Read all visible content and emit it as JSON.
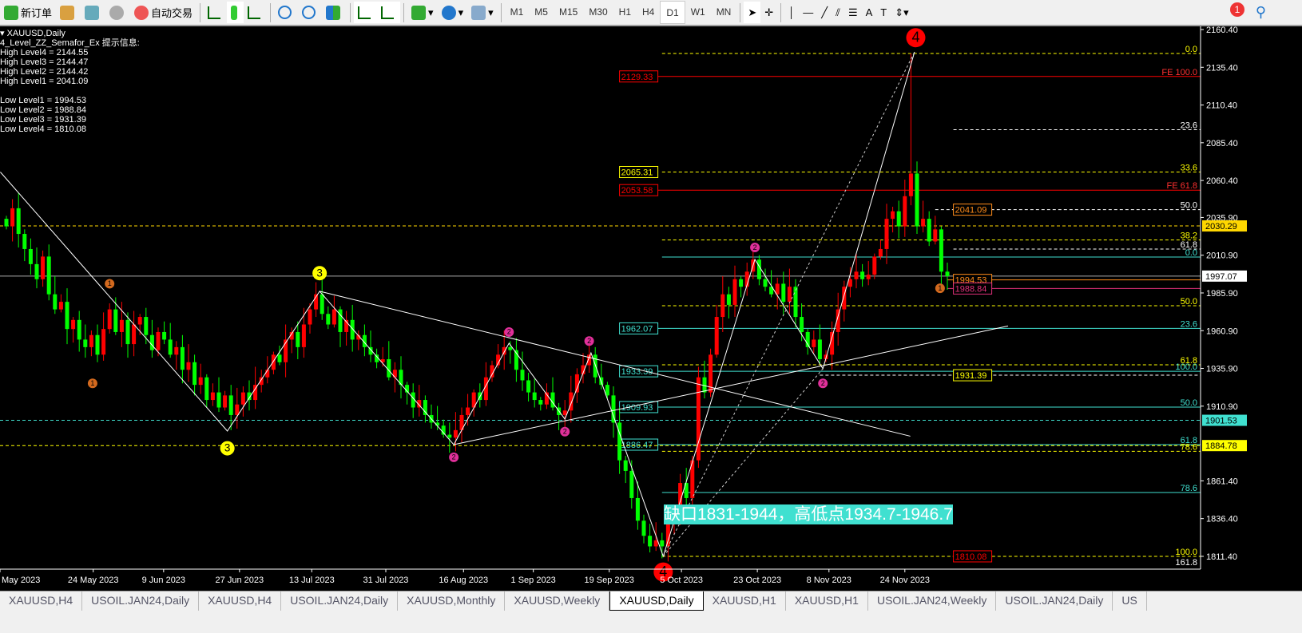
{
  "toolbar": {
    "new_order": "新订单",
    "auto_trading": "自动交易",
    "timeframes": [
      "M1",
      "M5",
      "M15",
      "M30",
      "H1",
      "H4",
      "D1",
      "W1",
      "MN"
    ],
    "active_timeframe": "D1",
    "alert_count": "1"
  },
  "info": {
    "symbol": "XAUUSD,Daily",
    "indicator": "4_Level_ZZ_Semafor_Ex 提示信息:",
    "lines": [
      "High Level4 = 2144.55",
      "High Level3 = 2144.47",
      "High Level2 = 2144.42",
      "High Level1 = 2041.09",
      "",
      "Low Level1 = 1994.53",
      "Low Level2 = 1988.84",
      "Low Level3 = 1931.39",
      "Low Level4 = 1810.08"
    ]
  },
  "annotation": "缺口1831-1944，高低点1934.7-1946.7",
  "tabs": [
    "XAUUSD,H4",
    "USOIL.JAN24,Daily",
    "XAUUSD,H4",
    "USOIL.JAN24,Daily",
    "XAUUSD,Monthly",
    "XAUUSD,Weekly",
    "XAUUSD,Daily",
    "XAUUSD,H1",
    "XAUUSD,H1",
    "USOIL.JAN24,Weekly",
    "USOIL.JAN24,Daily",
    "US"
  ],
  "active_tab": 6,
  "chart_data": {
    "type": "candlestick",
    "symbol": "XAUUSD",
    "timeframe": "Daily",
    "ylim": [
      1804,
      2162
    ],
    "bull_color": "#ff0000",
    "bear_color": "#00ff00",
    "closes": [
      2030,
      2042,
      2025,
      2015,
      2005,
      1995,
      2010,
      1985,
      1975,
      1980,
      1962,
      1968,
      1955,
      1950,
      1958,
      1945,
      1962,
      1975,
      1960,
      1968,
      1952,
      1965,
      1970,
      1958,
      1948,
      1960,
      1955,
      1945,
      1950,
      1935,
      1940,
      1925,
      1930,
      1915,
      1920,
      1910,
      1918,
      1905,
      1912,
      1920,
      1915,
      1925,
      1930,
      1935,
      1945,
      1940,
      1955,
      1960,
      1950,
      1965,
      1975,
      1985,
      1972,
      1965,
      1975,
      1960,
      1968,
      1955,
      1958,
      1950,
      1945,
      1940,
      1942,
      1930,
      1935,
      1925,
      1920,
      1910,
      1915,
      1905,
      1900,
      1898,
      1892,
      1890,
      1895,
      1905,
      1910,
      1920,
      1915,
      1930,
      1938,
      1945,
      1950,
      1948,
      1935,
      1928,
      1920,
      1915,
      1912,
      1920,
      1910,
      1905,
      1908,
      1920,
      1932,
      1938,
      1945,
      1930,
      1925,
      1918,
      1900,
      1875,
      1868,
      1850,
      1835,
      1825,
      1818,
      1822,
      1818,
      1835,
      1840,
      1860,
      1850,
      1875,
      1930,
      1920,
      1945,
      1970,
      1985,
      1978,
      1995,
      1990,
      2000,
      2008,
      1995,
      1990,
      1985,
      1992,
      1980,
      1990,
      1970,
      1960,
      1950,
      1955,
      1942,
      1945,
      1960,
      1975,
      1990,
      1995,
      2000,
      1995,
      1998,
      2010,
      2015,
      2035,
      2040,
      2030,
      2050,
      2065,
      2030,
      2035,
      2020,
      2028,
      2000,
      1997
    ],
    "high_overrides": {
      "149": 2144.55,
      "108": 1810.08
    },
    "y_ticks": [
      "2160.40",
      "2135.40",
      "2110.40",
      "2085.40",
      "2060.40",
      "2035.90",
      "2010.90",
      "1985.90",
      "1960.90",
      "1935.90",
      "1910.90",
      "1861.40",
      "1836.40",
      "1811.40"
    ],
    "x_ticks": [
      {
        "i": 2,
        "label": "May 2023"
      },
      {
        "i": 14.3,
        "label": "24 May 2023"
      },
      {
        "i": 25.9,
        "label": "9 Jun 2023"
      },
      {
        "i": 38.4,
        "label": "27 Jun 2023"
      },
      {
        "i": 50.3,
        "label": "13 Jul 2023"
      },
      {
        "i": 62.5,
        "label": "31 Jul 2023"
      },
      {
        "i": 75.3,
        "label": "16 Aug 2023"
      },
      {
        "i": 86.8,
        "label": "1 Sep 2023"
      },
      {
        "i": 99.3,
        "label": "19 Sep 2023"
      },
      {
        "i": 111.2,
        "label": "5 Oct 2023"
      },
      {
        "i": 123.7,
        "label": "23 Oct 2023"
      },
      {
        "i": 135.5,
        "label": "8 Nov 2023"
      },
      {
        "i": 148,
        "label": "24 Nov 2023"
      }
    ],
    "price_tags": [
      {
        "price": 2030.29,
        "label": "2030.29",
        "color": "#ffd700"
      },
      {
        "price": 1997.07,
        "label": "1997.07",
        "color": "#ffffff"
      },
      {
        "price": 1901.53,
        "label": "1901.53",
        "color": "#40e0d0"
      },
      {
        "price": 1884.78,
        "label": "1884.78",
        "color": "#ffff00"
      }
    ],
    "levels": [
      {
        "price": 2144.55,
        "from": 108,
        "color": "#ffff00",
        "dash": true,
        "label": "0.0"
      },
      {
        "price": 2129.33,
        "from": 101,
        "color": "#ff0000",
        "dash": false,
        "label": "FE 100.0",
        "box": "2129.33",
        "box_at": 101
      },
      {
        "price": 2094,
        "from": 156,
        "color": "#ffffff",
        "dash": true,
        "label": "23.6"
      },
      {
        "price": 2066,
        "from": 108,
        "color": "#ffff00",
        "dash": true,
        "label": "33.6",
        "box": "2065.31",
        "box_at": 101
      },
      {
        "price": 2054,
        "from": 101,
        "color": "#ff0000",
        "dash": false,
        "label": "FE 61.8",
        "box": "2053.58",
        "box_at": 101
      },
      {
        "price": 2041.09,
        "from": 153,
        "color": "#ffffff",
        "dash": true,
        "label": "50.0",
        "box": "2041.09",
        "box_at": 156,
        "box_color": "#ff8c1a"
      },
      {
        "price": 2030.29,
        "from": -2,
        "color": "#ffd700",
        "dash": true,
        "label": ""
      },
      {
        "price": 2021,
        "from": 108,
        "color": "#ffff00",
        "dash": true,
        "label": "38.2"
      },
      {
        "price": 2015,
        "from": 156,
        "color": "#ffffff",
        "dash": true,
        "label": "61.8"
      },
      {
        "price": 2009.7,
        "from": 108,
        "color": "#40e0d0",
        "dash": false,
        "label": "0.0"
      },
      {
        "price": 1997.07,
        "from": -2,
        "color": "#aaaaaa",
        "dash": false,
        "label": ""
      },
      {
        "price": 1994.53,
        "from": 155,
        "color": "#ff8c1a",
        "dash": false,
        "label": "",
        "box": "1994.53",
        "box_at": 156,
        "box_color": "#ff8c1a"
      },
      {
        "price": 1988.84,
        "from": 155,
        "color": "#e0307a",
        "dash": false,
        "label": "",
        "box": "1988.84",
        "box_at": 156,
        "box_color": "#e0307a"
      },
      {
        "price": 1977.4,
        "from": 108,
        "color": "#ffff00",
        "dash": true,
        "label": "50.0"
      },
      {
        "price": 1962.4,
        "from": 101,
        "color": "#40e0d0",
        "dash": false,
        "label": "23.6",
        "box": "1962.07",
        "box_at": 101
      },
      {
        "price": 1938.3,
        "from": 108,
        "color": "#ffff00",
        "dash": true,
        "label": "61.8"
      },
      {
        "price": 1934,
        "from": 101,
        "color": "#40e0d0",
        "dash": false,
        "label": "100.0",
        "box": "1933.39",
        "box_at": 101
      },
      {
        "price": 1931.39,
        "from": 134,
        "color": "#ffffff",
        "dash": true,
        "label": "",
        "box": "1931.39",
        "box_at": 156,
        "box_color": "#ffff00"
      },
      {
        "price": 1910.3,
        "from": 101,
        "color": "#40e0d0",
        "dash": false,
        "label": "50.0",
        "box": "1909.93",
        "box_at": 101
      },
      {
        "price": 1901.53,
        "from": -2,
        "color": "#40e0d0",
        "dash": true,
        "label": ""
      },
      {
        "price": 1885.4,
        "from": 101,
        "color": "#40e0d0",
        "dash": false,
        "label": "61.8",
        "box": "1886.47",
        "box_at": 101
      },
      {
        "price": 1884.78,
        "from": -2,
        "color": "#ffff00",
        "dash": true,
        "label": ""
      },
      {
        "price": 1881,
        "from": 108,
        "color": "#ffff00",
        "dash": true,
        "label": "78.6"
      },
      {
        "price": 1853.7,
        "from": 108,
        "color": "#40e0d0",
        "dash": false,
        "label": "78.6"
      },
      {
        "price": 1811.4,
        "from": 108,
        "color": "#ffff00",
        "dash": true,
        "label": "100.0",
        "box": "1810.08",
        "box_at": 156,
        "box_color": "#ff0000"
      },
      {
        "price": 1804.5,
        "from": 108,
        "color": "#000000",
        "dash": false,
        "label": "161.8"
      }
    ],
    "zigzag": [
      [
        -1,
        2066
      ],
      [
        36.4,
        1894.4
      ],
      [
        51.6,
        1987
      ],
      [
        73.7,
        1885.4
      ],
      [
        82.8,
        1952.6
      ],
      [
        92,
        1902.3
      ],
      [
        96.3,
        1946.2
      ],
      [
        108.2,
        1811.4
      ],
      [
        123.3,
        2008.1
      ],
      [
        134.5,
        1935.7
      ],
      [
        149.6,
        2145.6
      ]
    ],
    "trendlines": [
      [
        [
          51.6,
          1987
        ],
        [
          148.9,
          1891
        ]
      ],
      [
        [
          73.7,
          1885.4
        ],
        [
          165,
          1964
        ]
      ]
    ],
    "dashed_lines": [
      [
        [
          108.2,
          1811.4
        ],
        [
          149.6,
          2145.6
        ]
      ],
      [
        [
          108.2,
          1811.4
        ],
        [
          134.5,
          1935.7
        ]
      ]
    ],
    "markers": [
      {
        "i": 17,
        "price": 1992,
        "n": "1",
        "color": "#d2691e"
      },
      {
        "i": 14.2,
        "price": 1926,
        "n": "1",
        "color": "#d2691e"
      },
      {
        "i": 153.8,
        "price": 1989,
        "n": "1",
        "color": "#d2691e"
      },
      {
        "i": 36.4,
        "price": 1883,
        "n": "3",
        "color": "#ffff00"
      },
      {
        "i": 51.6,
        "price": 1999,
        "n": "3",
        "color": "#ffff00"
      },
      {
        "i": 73.7,
        "price": 1877,
        "n": "2",
        "color": "#e0309a"
      },
      {
        "i": 82.8,
        "price": 1960,
        "n": "2",
        "color": "#e0309a"
      },
      {
        "i": 92,
        "price": 1894,
        "n": "2",
        "color": "#e0309a"
      },
      {
        "i": 96,
        "price": 1954,
        "n": "2",
        "color": "#e0309a"
      },
      {
        "i": 123.3,
        "price": 2016,
        "n": "2",
        "color": "#e0309a"
      },
      {
        "i": 134.5,
        "price": 1926,
        "n": "2",
        "color": "#e0309a"
      },
      {
        "i": 149.8,
        "price": 2155,
        "n": "4",
        "color": "#ff0000"
      },
      {
        "i": 108.2,
        "price": 1801,
        "n": "4",
        "color": "#ff0000"
      }
    ]
  }
}
